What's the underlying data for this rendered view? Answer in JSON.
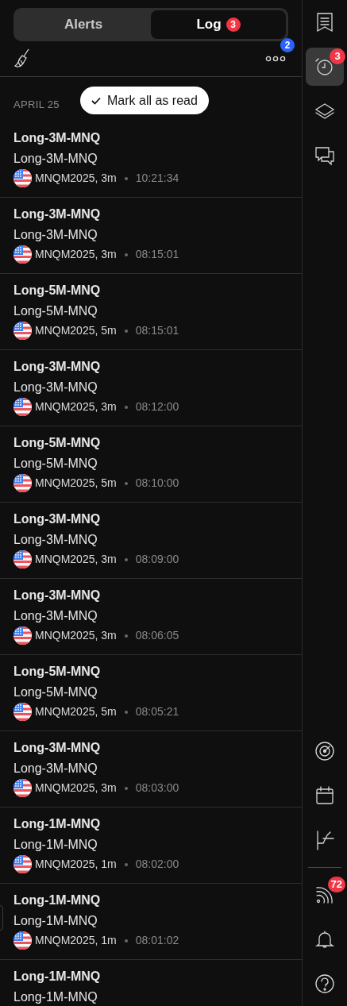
{
  "tabs": [
    {
      "label": "Alerts",
      "selected": false
    },
    {
      "label": "Log",
      "selected": true,
      "badge": "3"
    }
  ],
  "toolbar": {
    "more_badge": "2"
  },
  "date_header": "APRIL 25",
  "mark_all_button": "Mark all as read",
  "log": [
    {
      "title": "Long-3M-MNQ",
      "message": "Long-3M-MNQ",
      "symbol": "MNQM2025, 3m",
      "time": "10:21:34"
    },
    {
      "title": "Long-3M-MNQ",
      "message": "Long-3M-MNQ",
      "symbol": "MNQM2025, 3m",
      "time": "08:15:01"
    },
    {
      "title": "Long-5M-MNQ",
      "message": "Long-5M-MNQ",
      "symbol": "MNQM2025, 5m",
      "time": "08:15:01"
    },
    {
      "title": "Long-3M-MNQ",
      "message": "Long-3M-MNQ",
      "symbol": "MNQM2025, 3m",
      "time": "08:12:00"
    },
    {
      "title": "Long-5M-MNQ",
      "message": "Long-5M-MNQ",
      "symbol": "MNQM2025, 5m",
      "time": "08:10:00"
    },
    {
      "title": "Long-3M-MNQ",
      "message": "Long-3M-MNQ",
      "symbol": "MNQM2025, 3m",
      "time": "08:09:00"
    },
    {
      "title": "Long-3M-MNQ",
      "message": "Long-3M-MNQ",
      "symbol": "MNQM2025, 3m",
      "time": "08:06:05"
    },
    {
      "title": "Long-5M-MNQ",
      "message": "Long-5M-MNQ",
      "symbol": "MNQM2025, 5m",
      "time": "08:05:21"
    },
    {
      "title": "Long-3M-MNQ",
      "message": "Long-3M-MNQ",
      "symbol": "MNQM2025, 3m",
      "time": "08:03:00"
    },
    {
      "title": "Long-1M-MNQ",
      "message": "Long-1M-MNQ",
      "symbol": "MNQM2025, 1m",
      "time": "08:02:00"
    },
    {
      "title": "Long-1M-MNQ",
      "message": "Long-1M-MNQ",
      "symbol": "MNQM2025, 1m",
      "time": "08:01:02"
    },
    {
      "title": "Long-1M-MNQ",
      "message": "Long-1M-MNQ"
    }
  ],
  "sidebar": {
    "top": [
      {
        "kind": "watchlist",
        "selected": false
      },
      {
        "kind": "alarm",
        "selected": true,
        "badge": "3"
      },
      {
        "kind": "layers",
        "selected": false
      },
      {
        "kind": "chat",
        "selected": false
      }
    ],
    "bottom": [
      {
        "kind": "radar",
        "selected": false
      },
      {
        "kind": "calendar",
        "selected": false
      },
      {
        "kind": "chart-tool",
        "selected": false
      },
      {
        "kind": "divider"
      },
      {
        "kind": "signal",
        "selected": false,
        "badge": "72"
      },
      {
        "kind": "bell",
        "selected": false
      },
      {
        "kind": "help",
        "selected": false
      }
    ]
  }
}
